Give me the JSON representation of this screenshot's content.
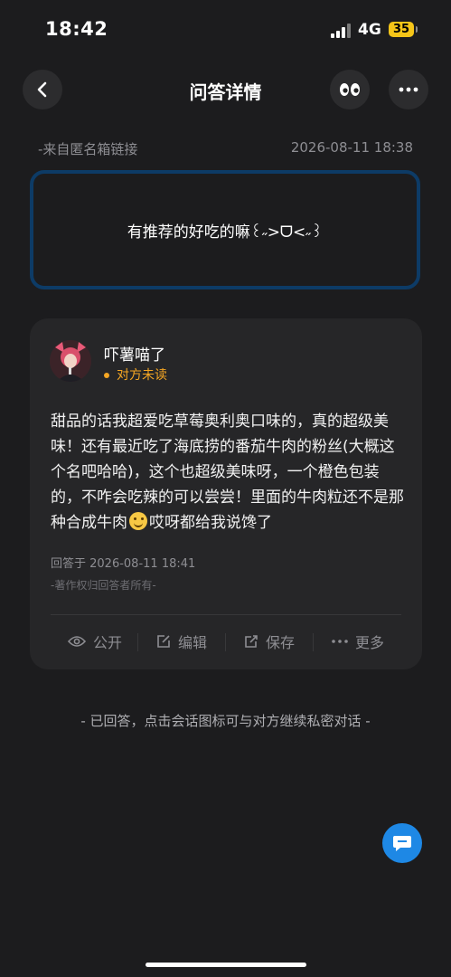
{
  "status_bar": {
    "time": "18:42",
    "network": "4G",
    "battery": "35"
  },
  "nav": {
    "title": "问答详情",
    "back_icon": "chevron-left-icon",
    "eyes_icon": "eyes-icon",
    "more_icon": "more-dots-icon"
  },
  "question": {
    "source": "-来自匿名箱链接",
    "datetime": "2026-08-11 18:38",
    "text": "有推荐的好吃的嘛꒰˶>ᗜ<˶꒱"
  },
  "answer": {
    "user_name": "吓薯喵了",
    "read_status": "对方未读",
    "text_part1": "甜品的话我超爱吃草莓奥利奥口味的，真的超级美味！还有最近吃了海底捞的番茄牛肉的粉丝(大概这个名吧哈哈)，这个也超级美味呀，一个橙色包装的，不咋会吃辣的可以尝尝！里面的牛肉粒还不是那种合成牛肉",
    "text_part2": "哎呀都给我说馋了",
    "answered_at": "回答于 2026-08-11 18:41",
    "copyright": "-著作权归回答者所有-"
  },
  "actions": {
    "public": "公开",
    "edit": "编辑",
    "save": "保存",
    "more": "更多"
  },
  "footer": {
    "note": "- 已回答，点击会话图标可与对方继续私密对话 -"
  },
  "colors": {
    "background": "#1c1c1e",
    "card": "#262628",
    "question_border": "#0d3b66",
    "accent_orange": "#f5a623",
    "fab_blue": "#1e88e5"
  }
}
